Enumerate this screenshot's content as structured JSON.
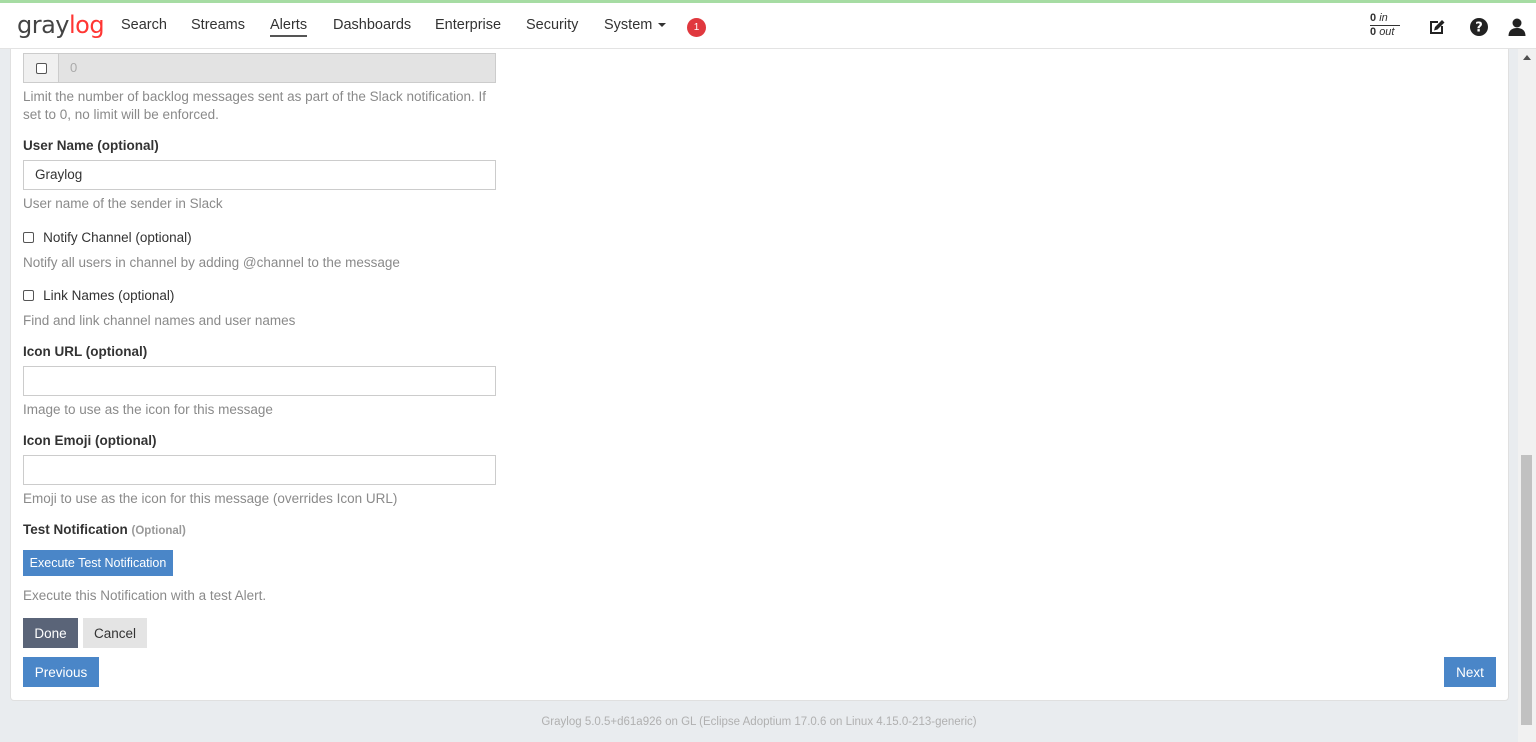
{
  "brand": {
    "prefix": "gray",
    "suffix": "log"
  },
  "nav": {
    "items": [
      {
        "label": "Search"
      },
      {
        "label": "Streams"
      },
      {
        "label": "Alerts"
      },
      {
        "label": "Dashboards"
      },
      {
        "label": "Enterprise"
      },
      {
        "label": "Security"
      },
      {
        "label": "System"
      }
    ],
    "notification_count": "1"
  },
  "throughput": {
    "in_value": "0",
    "in_label": "in",
    "out_value": "0",
    "out_label": "out"
  },
  "form": {
    "backlog": {
      "value": "0",
      "help": "Limit the number of backlog messages sent as part of the Slack notification. If set to 0, no limit will be enforced."
    },
    "user_name": {
      "label": "User Name (optional)",
      "value": "Graylog",
      "help": "User name of the sender in Slack"
    },
    "notify_channel": {
      "label": "Notify Channel (optional)",
      "help": "Notify all users in channel by adding @channel to the message"
    },
    "link_names": {
      "label": "Link Names (optional)",
      "help": "Find and link channel names and user names"
    },
    "icon_url": {
      "label": "Icon URL (optional)",
      "value": "",
      "help": "Image to use as the icon for this message"
    },
    "icon_emoji": {
      "label": "Icon Emoji (optional)",
      "value": "",
      "help": "Emoji to use as the icon for this message (overrides Icon URL)"
    },
    "test_notification": {
      "label": "Test Notification",
      "optional": "(Optional)",
      "button": "Execute Test Notification",
      "help": "Execute this Notification with a test Alert."
    }
  },
  "actions": {
    "done": "Done",
    "cancel": "Cancel",
    "previous": "Previous",
    "next": "Next"
  },
  "footer": {
    "text": "Graylog 5.0.5+d61a926 on GL (Eclipse Adoptium 17.0.6 on Linux 4.15.0-213-generic)"
  }
}
